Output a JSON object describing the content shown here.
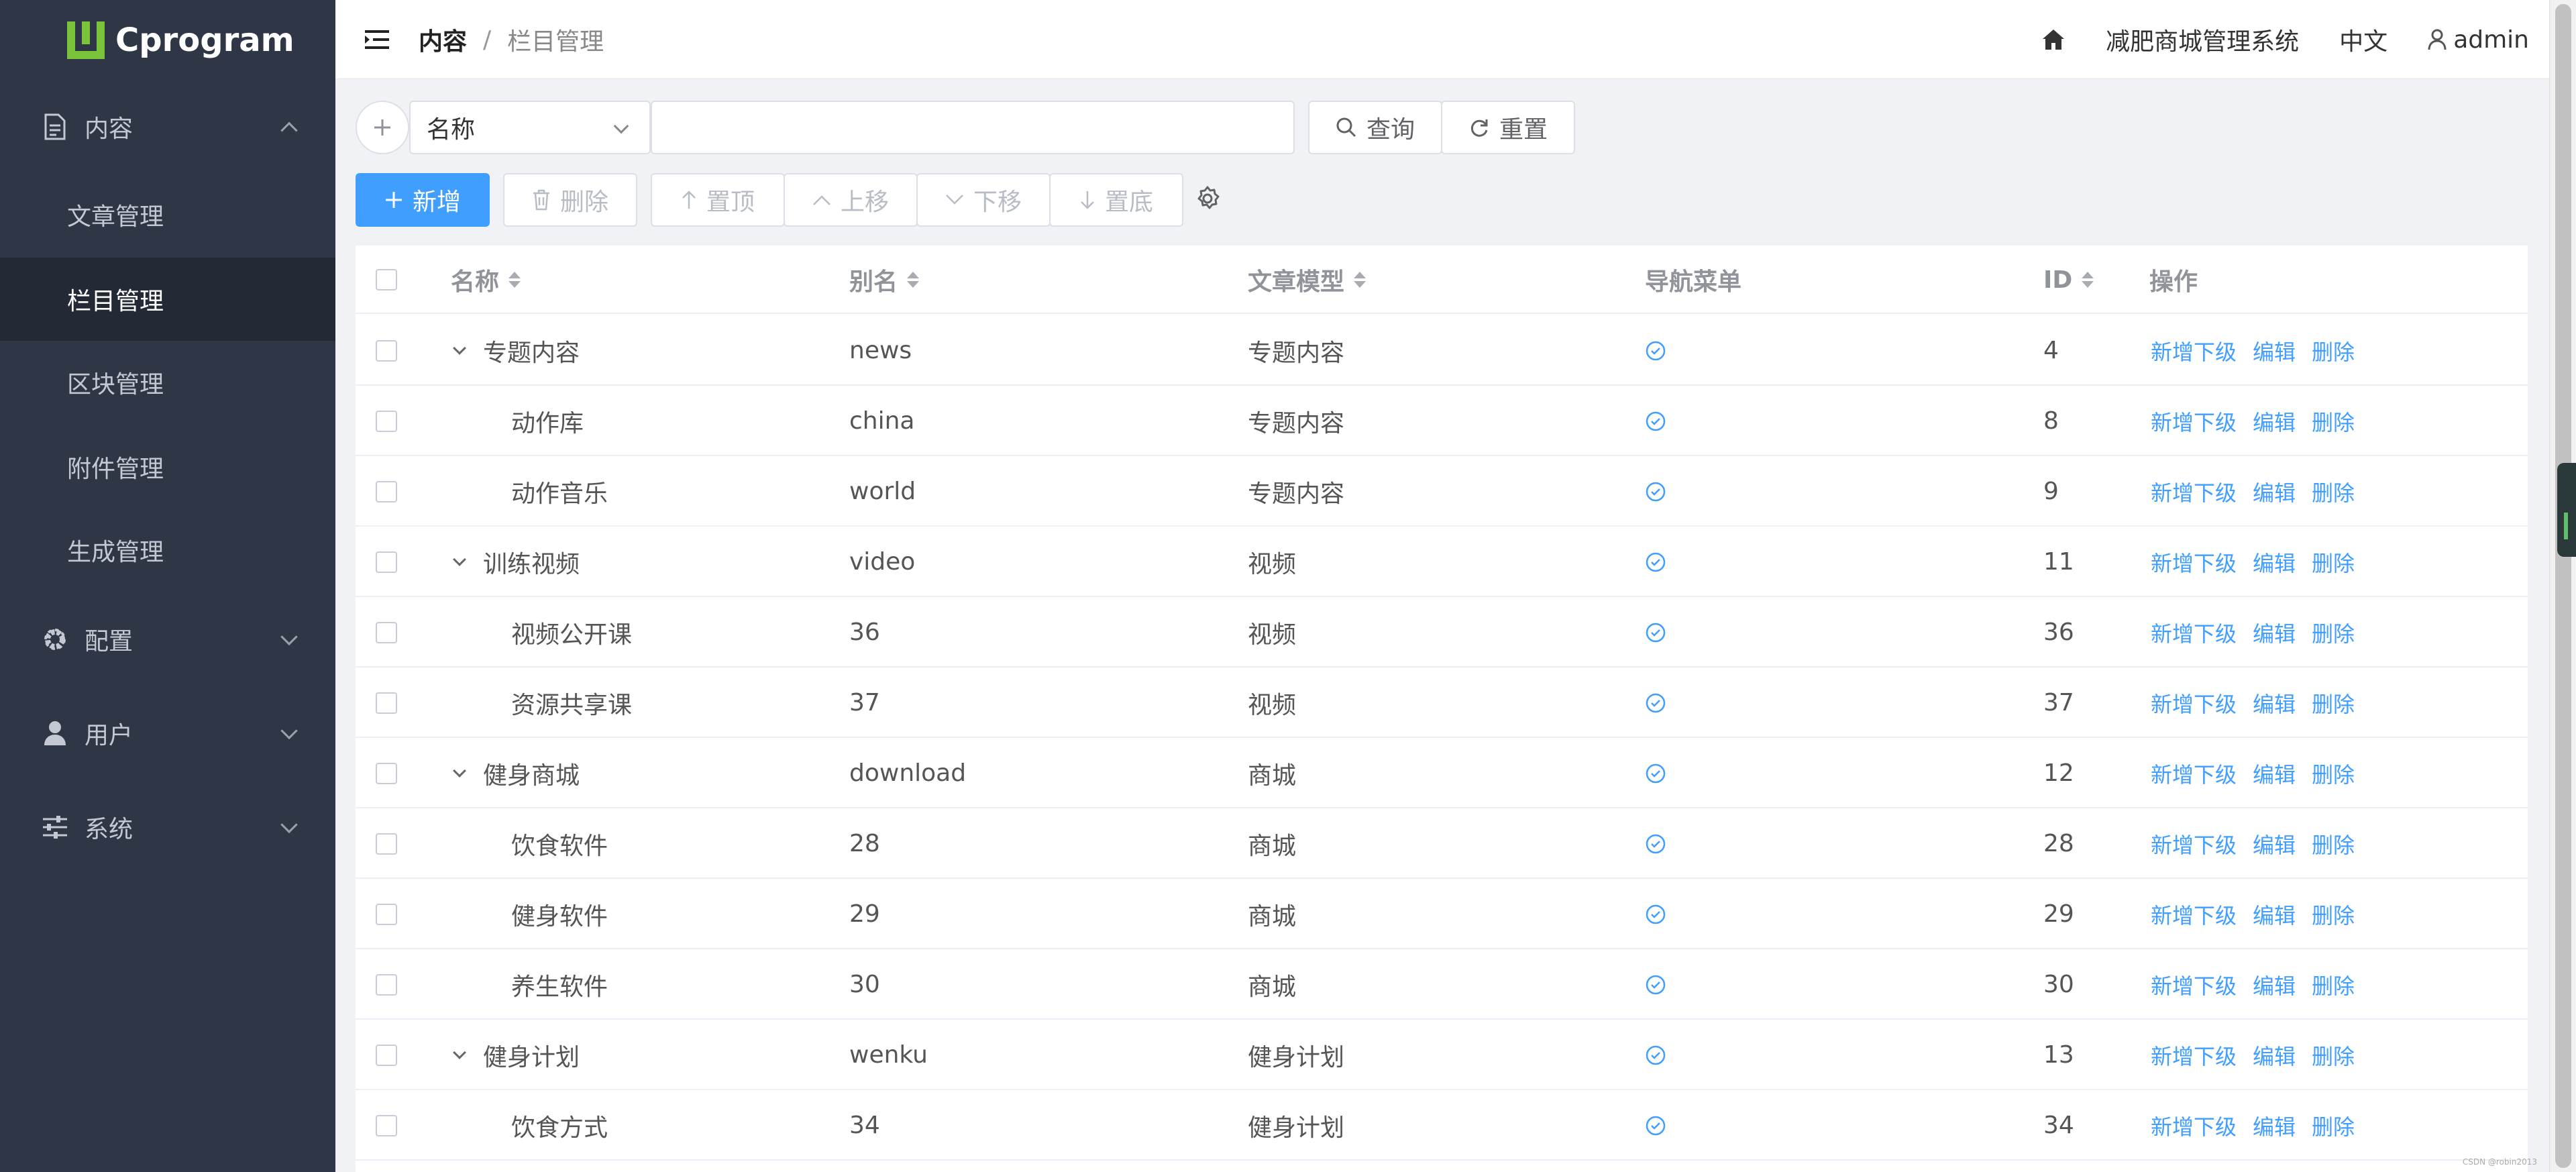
{
  "app": {
    "name": "Cprogram"
  },
  "sidebar": {
    "groups": [
      {
        "label": "内容",
        "icon": "document-icon",
        "expanded": true
      },
      {
        "label": "配置",
        "icon": "gear-icon",
        "expanded": false
      },
      {
        "label": "用户",
        "icon": "user-icon",
        "expanded": false
      },
      {
        "label": "系统",
        "icon": "sliders-icon",
        "expanded": false
      }
    ],
    "content_items": [
      {
        "label": "文章管理"
      },
      {
        "label": "栏目管理",
        "active": true
      },
      {
        "label": "区块管理"
      },
      {
        "label": "附件管理"
      },
      {
        "label": "生成管理"
      }
    ]
  },
  "header": {
    "breadcrumb": [
      "内容",
      "栏目管理"
    ],
    "separator": "/",
    "system_name": "减肥商城管理系统",
    "language": "中文",
    "user": "admin"
  },
  "search": {
    "field": "名称",
    "value": "",
    "query_label": "查询",
    "reset_label": "重置"
  },
  "toolbar": {
    "add": "新增",
    "delete": "删除",
    "top": "置顶",
    "up": "上移",
    "down": "下移",
    "bottom": "置底"
  },
  "table": {
    "columns": [
      "名称",
      "别名",
      "文章模型",
      "导航菜单",
      "ID",
      "操作"
    ],
    "rows": [
      {
        "name": "专题内容",
        "alias": "news",
        "model": "专题内容",
        "nav": true,
        "id": "4",
        "parent": true
      },
      {
        "name": "动作库",
        "alias": "china",
        "model": "专题内容",
        "nav": true,
        "id": "8",
        "parent": false
      },
      {
        "name": "动作音乐",
        "alias": "world",
        "model": "专题内容",
        "nav": true,
        "id": "9",
        "parent": false
      },
      {
        "name": "训练视频",
        "alias": "video",
        "model": "视频",
        "nav": true,
        "id": "11",
        "parent": true
      },
      {
        "name": "视频公开课",
        "alias": "36",
        "model": "视频",
        "nav": true,
        "id": "36",
        "parent": false
      },
      {
        "name": "资源共享课",
        "alias": "37",
        "model": "视频",
        "nav": true,
        "id": "37",
        "parent": false
      },
      {
        "name": "健身商城",
        "alias": "download",
        "model": "商城",
        "nav": true,
        "id": "12",
        "parent": true
      },
      {
        "name": "饮食软件",
        "alias": "28",
        "model": "商城",
        "nav": true,
        "id": "28",
        "parent": false
      },
      {
        "name": "健身软件",
        "alias": "29",
        "model": "商城",
        "nav": true,
        "id": "29",
        "parent": false
      },
      {
        "name": "养生软件",
        "alias": "30",
        "model": "商城",
        "nav": true,
        "id": "30",
        "parent": false
      },
      {
        "name": "健身计划",
        "alias": "wenku",
        "model": "健身计划",
        "nav": true,
        "id": "13",
        "parent": true
      },
      {
        "name": "饮食方式",
        "alias": "34",
        "model": "健身计划",
        "nav": true,
        "id": "34",
        "parent": false
      }
    ],
    "actions": {
      "add_child": "新增下级",
      "edit": "编辑",
      "delete": "删除"
    }
  },
  "watermark": "CSDN @robin2013",
  "colors": {
    "sidebar": "#2f3747",
    "primary": "#409eff",
    "brand": "#7bc43a"
  }
}
